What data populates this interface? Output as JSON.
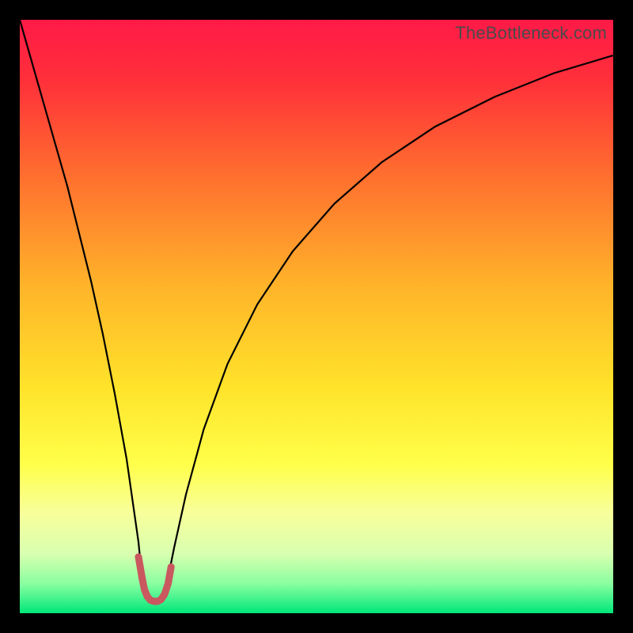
{
  "watermark": "TheBottleneck.com",
  "chart_data": {
    "type": "line",
    "title": "",
    "xlabel": "",
    "ylabel": "",
    "xlim": [
      0,
      100
    ],
    "ylim": [
      0,
      100
    ],
    "grid": false,
    "background_gradient": {
      "stops": [
        {
          "offset": 0.0,
          "color": "#ff1a47"
        },
        {
          "offset": 0.1,
          "color": "#ff2f3a"
        },
        {
          "offset": 0.25,
          "color": "#ff6a2f"
        },
        {
          "offset": 0.45,
          "color": "#ffb42a"
        },
        {
          "offset": 0.62,
          "color": "#ffe32a"
        },
        {
          "offset": 0.75,
          "color": "#ffff4a"
        },
        {
          "offset": 0.83,
          "color": "#f8ff9a"
        },
        {
          "offset": 0.9,
          "color": "#d8ffb0"
        },
        {
          "offset": 0.95,
          "color": "#8affa0"
        },
        {
          "offset": 1.0,
          "color": "#00e77a"
        }
      ]
    },
    "series": [
      {
        "name": "bottleneck-curve",
        "stroke": "#000000",
        "stroke_width": 2.2,
        "x": [
          0,
          4,
          8,
          12,
          14,
          16,
          18,
          19,
          20,
          20.5,
          21,
          21.6,
          22.5,
          23.3,
          24,
          24.5,
          25.2,
          26,
          28,
          31,
          35,
          40,
          46,
          53,
          61,
          70,
          80,
          90,
          100
        ],
        "y": [
          100,
          86,
          72,
          56,
          47,
          37,
          26,
          19,
          12,
          7,
          4,
          2.5,
          2.0,
          2.0,
          2.5,
          4,
          7,
          11,
          20,
          31,
          42,
          52,
          61,
          69,
          76,
          82,
          87,
          91,
          94
        ]
      },
      {
        "name": "sweet-spot-marker",
        "stroke": "#c9585f",
        "stroke_width": 9,
        "linecap": "round",
        "x": [
          20.0,
          20.6,
          21.0,
          21.5,
          22.0,
          22.6,
          23.2,
          23.8,
          24.4,
          25.0,
          25.5
        ],
        "y": [
          9.5,
          6.0,
          4.0,
          2.8,
          2.2,
          2.0,
          2.0,
          2.3,
          3.2,
          5.0,
          7.8
        ]
      }
    ]
  }
}
